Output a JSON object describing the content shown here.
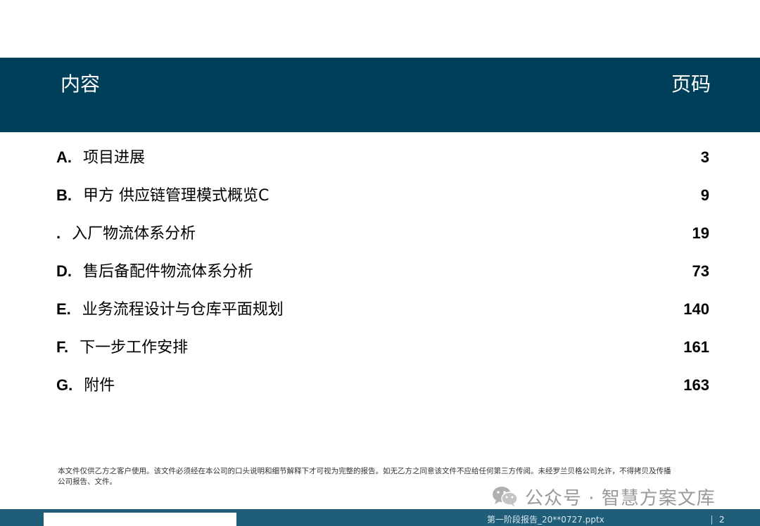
{
  "header": {
    "contents_label": "内容",
    "page_label": "页码"
  },
  "toc": [
    {
      "letter": "A.",
      "text": "项目进展",
      "page": "3"
    },
    {
      "letter": "B.",
      "text": "甲方 供应链管理模式概览C",
      "page": "9"
    },
    {
      "letter": ".",
      "text": "入厂物流体系分析",
      "page": "19"
    },
    {
      "letter": "D.",
      "text": "售后备配件物流体系分析",
      "page": "73"
    },
    {
      "letter": "E.",
      "text": "业务流程设计与仓库平面规划",
      "page": "140"
    },
    {
      "letter": "F.",
      "text": "下一步工作安排",
      "page": "161"
    },
    {
      "letter": "G.",
      "text": "附件",
      "page": "163"
    }
  ],
  "disclaimer": "本文件仅供乙方之客户使用。该文件必须经在本公司的口头说明和细节解释下才可视为完整的报告。如无乙方之同意该文件不应给任何第三方传阅。未经罗兰贝格公司允许，不得拷贝及传播公司报告、文件。",
  "watermark": {
    "icon": "wechat-icon",
    "text": "公众号 · 智慧方案文库"
  },
  "footer": {
    "filename": "第一阶段报告_20**0727.pptx",
    "page_number": "2"
  },
  "colors": {
    "header_band": "#003f5a",
    "footer_bar": "#1f5d78"
  }
}
